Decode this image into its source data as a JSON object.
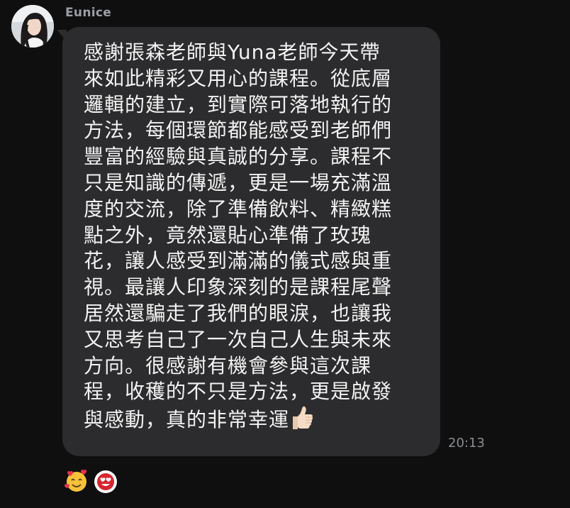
{
  "sender": {
    "name": "Eunice",
    "avatar_icon": "profile-photo"
  },
  "message": {
    "lines": [
      "感謝張森老師與Yuna老師今天帶",
      "來如此精彩又用心的課程。從底層",
      "邏輯的建立，到實際可落地執行的",
      "方法，每個環節都能感受到老師們",
      "豐富的經驗與真誠的分享。課程不",
      "只是知識的傳遞，更是一場充滿溫",
      "度的交流，除了準備飲料、精緻糕",
      "點之外，竟然還貼心準備了玫瑰",
      "花，讓人感受到滿滿的儀式感與重",
      "視。最讓人印象深刻的是課程尾聲",
      "居然還騙走了我們的眼淚，也讓我",
      "又思考自己了一次自己人生與未來",
      "方向。很感謝有機會參與這次課",
      "程，收穫的不只是方法，更是啟發",
      "與感動，真的非常幸運"
    ],
    "emoji": "thumbs-up-icon",
    "time": "20:13"
  },
  "reactions": [
    {
      "icon": "smiling-face-with-hearts-icon"
    },
    {
      "icon": "heart-eyes-face-icon"
    }
  ],
  "colors": {
    "background": "#0f0f10",
    "bubble": "#2c2c2e",
    "text": "#f2f2f2",
    "meta_text": "#8b8d92"
  }
}
